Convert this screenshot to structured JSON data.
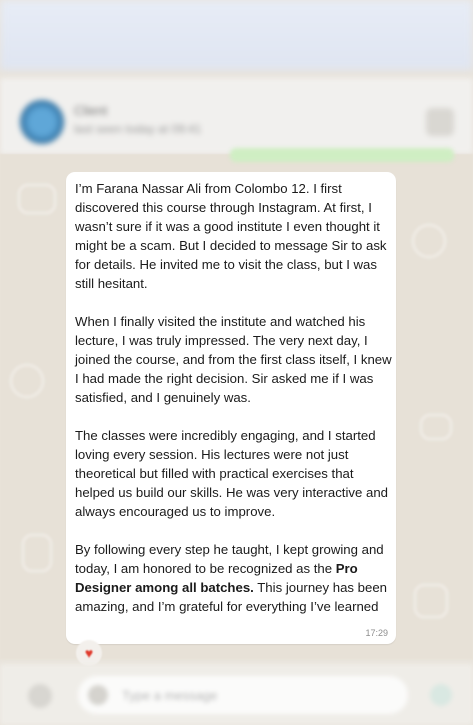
{
  "header": {
    "contact_name": "Client",
    "contact_status": "last seen today at 09:41"
  },
  "message": {
    "paragraphs": [
      "I’m Farana Nassar Ali from Colombo 12. I first discovered this course through Instagram. At first, I wasn’t sure if it was a good institute I even thought it might be a scam. But I decided to message Sir to ask for details. He invited me to visit the class, but I was still hesitant.",
      "When I finally visited the institute and watched his lecture, I was truly impressed. The very next day, I joined the course, and from the first class itself, I knew I had made the right decision. Sir asked me if I was satisfied, and I genuinely was.",
      "The classes were incredibly engaging, and I started loving every session. His lectures were not just theoretical but filled with practical exercises that helped us build our skills. He was very interactive and always encouraged us to improve."
    ],
    "last_paragraph_start": "By following every step he taught, I kept growing and today, I am honored to be recognized as the",
    "last_paragraph_bold": "Pro Designer among all batches.",
    "last_paragraph_end": " This journey has been amazing, and I’m grateful for everything I’ve learned",
    "time": "17:29"
  },
  "reaction": {
    "icon": "heart-icon",
    "glyph": "♥",
    "color": "#e0392b"
  },
  "composer": {
    "placeholder": "Type a message"
  }
}
